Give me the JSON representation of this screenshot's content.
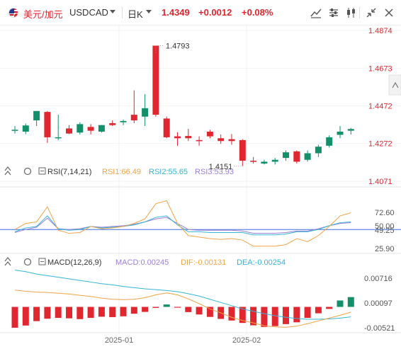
{
  "header": {
    "pair_cn": "美元/加元",
    "symbol": "USDCAD",
    "period": "日K",
    "price": "1.4349",
    "change": "+0.0012",
    "change_pct": "+0.08%"
  },
  "colors": {
    "up": "#e0262f",
    "down": "#13906a",
    "rsi1": "#f0a347",
    "rsi2": "#35b4d6",
    "rsi3": "#9b7fd6",
    "dif": "#f0a347",
    "dea": "#35b4d6",
    "ref_line": "#3a6fe0"
  },
  "panels": {
    "rsi": {
      "name": "RSI(7,14,21)",
      "rsi1": "RSI1:66.49",
      "rsi2": "RSI2:55.65",
      "rsi3": "RSI3:53.93"
    },
    "macd": {
      "name": "MACD(12,26,9)",
      "macd": "MACD:0.00245",
      "dif": "DIF:-0.00131",
      "dea": "DEA:-0.00254"
    }
  },
  "chart_data": {
    "type": "candlestick",
    "price_axis_ticks": [
      "1.4874",
      "1.4673",
      "1.4472",
      "1.4272",
      "1.4071"
    ],
    "price_axis_values": [
      1.4874,
      1.4673,
      1.4472,
      1.4272,
      1.4071
    ],
    "annotations": {
      "high_label": "1.4793",
      "high_value": 1.4793,
      "low_label": "1.4151",
      "low_value": 1.4151
    },
    "x_tick_labels": [
      "2025-01",
      "2025-02"
    ],
    "candles": [
      {
        "o": 1.4345,
        "h": 1.4365,
        "l": 1.4325,
        "c": 1.4345
      },
      {
        "o": 1.4335,
        "h": 1.4378,
        "l": 1.4322,
        "c": 1.4368
      },
      {
        "o": 1.4395,
        "h": 1.4445,
        "l": 1.4365,
        "c": 1.4445
      },
      {
        "o": 1.444,
        "h": 1.4445,
        "l": 1.4275,
        "c": 1.4305
      },
      {
        "o": 1.43,
        "h": 1.4425,
        "l": 1.429,
        "c": 1.4305
      },
      {
        "o": 1.4352,
        "h": 1.437,
        "l": 1.4322,
        "c": 1.4325
      },
      {
        "o": 1.433,
        "h": 1.4385,
        "l": 1.432,
        "c": 1.4375
      },
      {
        "o": 1.436,
        "h": 1.4375,
        "l": 1.432,
        "c": 1.434
      },
      {
        "o": 1.4335,
        "h": 1.437,
        "l": 1.433,
        "c": 1.437
      },
      {
        "o": 1.438,
        "h": 1.4395,
        "l": 1.4365,
        "c": 1.437
      },
      {
        "o": 1.4385,
        "h": 1.44,
        "l": 1.437,
        "c": 1.4392
      },
      {
        "o": 1.4425,
        "h": 1.4555,
        "l": 1.438,
        "c": 1.4395
      },
      {
        "o": 1.4415,
        "h": 1.4535,
        "l": 1.4365,
        "c": 1.446
      },
      {
        "o": 1.4793,
        "h": 1.4793,
        "l": 1.4415,
        "c": 1.4425
      },
      {
        "o": 1.4405,
        "h": 1.4415,
        "l": 1.43,
        "c": 1.4305
      },
      {
        "o": 1.431,
        "h": 1.4332,
        "l": 1.426,
        "c": 1.43
      },
      {
        "o": 1.4312,
        "h": 1.435,
        "l": 1.4285,
        "c": 1.43
      },
      {
        "o": 1.429,
        "h": 1.431,
        "l": 1.426,
        "c": 1.4285
      },
      {
        "o": 1.4335,
        "h": 1.4345,
        "l": 1.43,
        "c": 1.431
      },
      {
        "o": 1.43,
        "h": 1.432,
        "l": 1.427,
        "c": 1.4285
      },
      {
        "o": 1.4295,
        "h": 1.4322,
        "l": 1.4265,
        "c": 1.4285
      },
      {
        "o": 1.429,
        "h": 1.4295,
        "l": 1.4151,
        "c": 1.418
      },
      {
        "o": 1.418,
        "h": 1.42,
        "l": 1.4165,
        "c": 1.4175
      },
      {
        "o": 1.4165,
        "h": 1.4185,
        "l": 1.416,
        "c": 1.4175
      },
      {
        "o": 1.4175,
        "h": 1.4195,
        "l": 1.416,
        "c": 1.4185
      },
      {
        "o": 1.4195,
        "h": 1.4235,
        "l": 1.418,
        "c": 1.4225
      },
      {
        "o": 1.423,
        "h": 1.4235,
        "l": 1.4165,
        "c": 1.4175
      },
      {
        "o": 1.4185,
        "h": 1.4235,
        "l": 1.4175,
        "c": 1.422
      },
      {
        "o": 1.422,
        "h": 1.4265,
        "l": 1.42,
        "c": 1.4255
      },
      {
        "o": 1.426,
        "h": 1.4315,
        "l": 1.425,
        "c": 1.4305
      },
      {
        "o": 1.4318,
        "h": 1.4365,
        "l": 1.43,
        "c": 1.4335
      },
      {
        "o": 1.434,
        "h": 1.4355,
        "l": 1.432,
        "c": 1.4349
      }
    ],
    "rsi": {
      "ticks": [
        "72.60",
        "50.00",
        "49.25",
        "25.90"
      ],
      "tick_values": [
        72.6,
        50.0,
        49.25,
        25.9
      ],
      "ylim": [
        20,
        90
      ],
      "rsi1": [
        50,
        58,
        60,
        80,
        49,
        45,
        46,
        54,
        51,
        52,
        54,
        58,
        64,
        84,
        88,
        58,
        42,
        40,
        38,
        37,
        38,
        36,
        28,
        28,
        28,
        30,
        38,
        34,
        42,
        54,
        68,
        72
      ],
      "rsi2": [
        47,
        52,
        54,
        68,
        51,
        49,
        50,
        54,
        52,
        53,
        54,
        56,
        60,
        66,
        68,
        56,
        47,
        47,
        46,
        46,
        46,
        46,
        43,
        43,
        43,
        44,
        47,
        47,
        50,
        55,
        59,
        60
      ],
      "rsi3": [
        46,
        50,
        53,
        65,
        51,
        50,
        51,
        54,
        53,
        54,
        55,
        57,
        60,
        64,
        66,
        58,
        50,
        49,
        49,
        49,
        49,
        48,
        45,
        45,
        45,
        46,
        48,
        48,
        51,
        55,
        58,
        59
      ]
    },
    "macd": {
      "ticks": [
        "0.00716",
        "0.00097",
        "-0.00521"
      ],
      "tick_values": [
        0.00716,
        0.00097,
        -0.00521
      ],
      "ylim": [
        -0.0065,
        0.0095
      ],
      "hist": [
        -0.0052,
        -0.00465,
        -0.00355,
        -0.00295,
        -0.00275,
        -0.00285,
        -0.00305,
        -0.00275,
        -0.00245,
        -0.00255,
        -0.00235,
        -0.0017,
        -0.00125,
        -0.00025,
        0.0006,
        -0.0002,
        -0.0013,
        -0.0019,
        -0.0025,
        -0.003,
        -0.0034,
        -0.004,
        -0.0046,
        -0.005,
        -0.0048,
        -0.0043,
        -0.00385,
        -0.00275,
        -0.0016,
        -0.0005,
        0.0016,
        0.00245
      ],
      "dif": [
        0.0042,
        0.0039,
        0.0037,
        0.0036,
        0.0034,
        0.0032,
        0.0029,
        0.0026,
        0.0022,
        0.0019,
        0.0018,
        0.0019,
        0.0023,
        0.003,
        0.0035,
        0.003,
        0.002,
        0.0008,
        -0.0005,
        -0.0015,
        -0.0026,
        -0.0034,
        -0.004,
        -0.0047,
        -0.005,
        -0.0051,
        -0.0048,
        -0.0042,
        -0.0035,
        -0.0028,
        -0.0021,
        -0.0013
      ],
      "dea": [
        0.0092,
        0.0088,
        0.0082,
        0.0078,
        0.0074,
        0.007,
        0.0066,
        0.0062,
        0.0058,
        0.0055,
        0.0051,
        0.0048,
        0.0045,
        0.0043,
        0.0041,
        0.0038,
        0.0033,
        0.0027,
        0.0019,
        0.0011,
        0.0003,
        -0.0005,
        -0.0011,
        -0.0017,
        -0.0022,
        -0.0026,
        -0.0029,
        -0.0031,
        -0.0031,
        -0.003,
        -0.0028,
        -0.0025
      ]
    }
  }
}
